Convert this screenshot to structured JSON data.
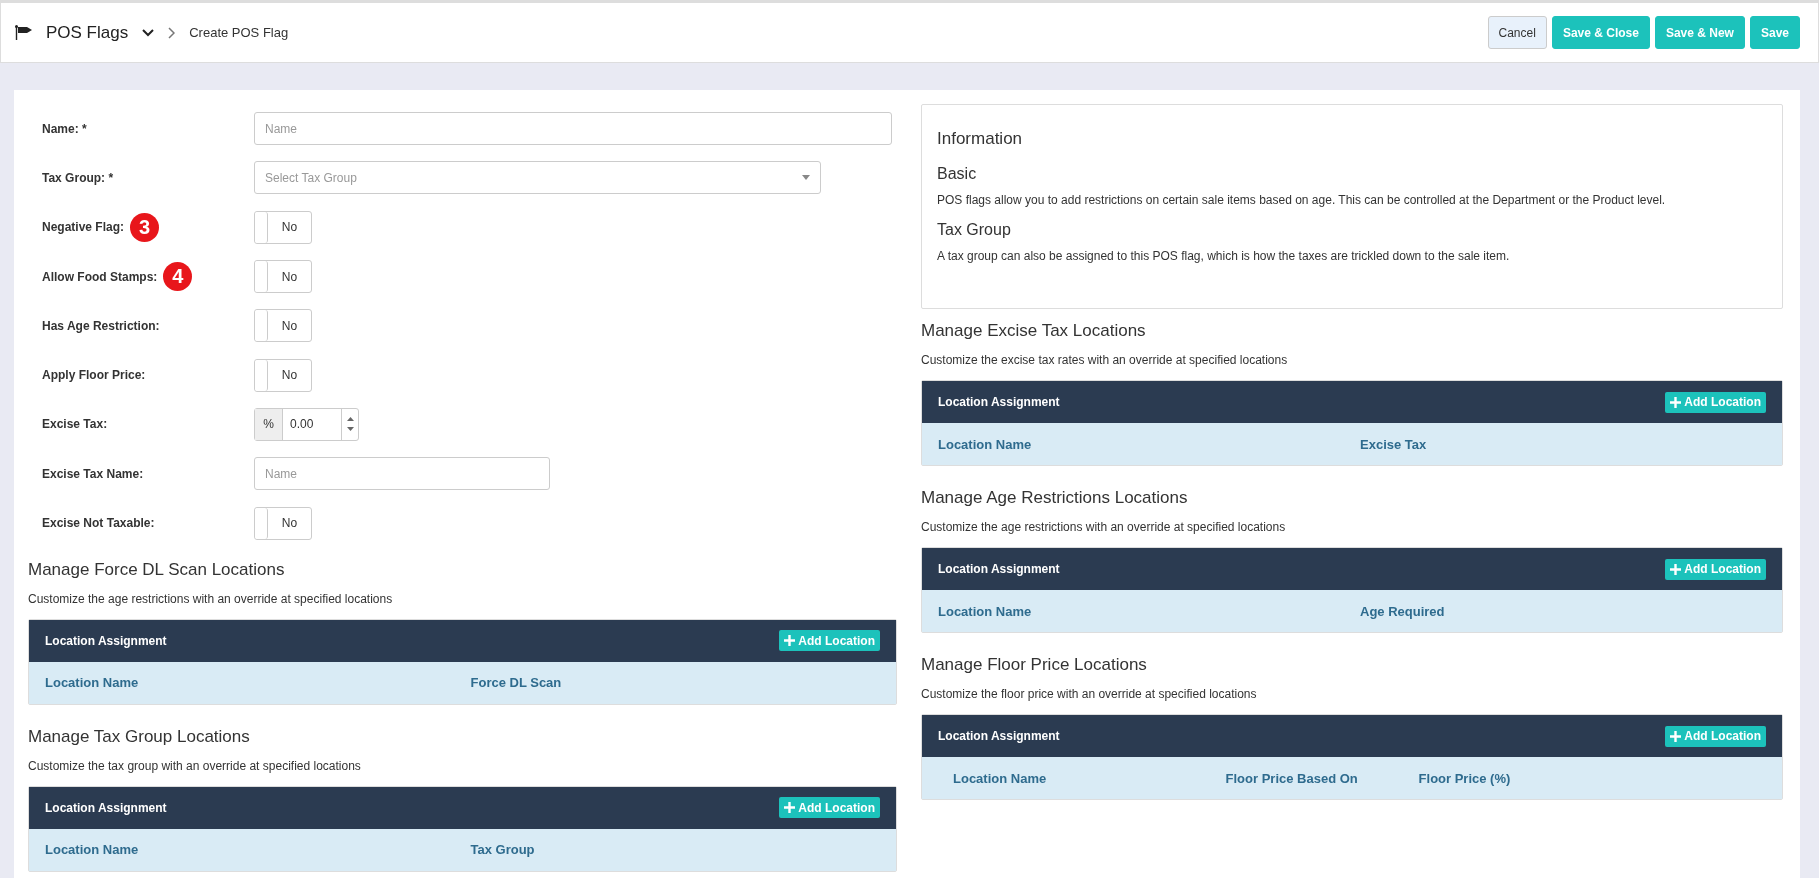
{
  "header": {
    "module": "POS Flags",
    "breadcrumb": "Create POS Flag",
    "buttons": [
      {
        "label": "Cancel",
        "kind": "secondary"
      },
      {
        "label": "Save & Close",
        "kind": "primary"
      },
      {
        "label": "Save & New",
        "kind": "primary"
      },
      {
        "label": "Save",
        "kind": "primary"
      }
    ]
  },
  "form": [
    {
      "kind": "wide_text",
      "label": "Name: *",
      "placeholder": "Name"
    },
    {
      "kind": "select",
      "label": "Tax Group: *",
      "placeholder": "Select Tax Group"
    },
    {
      "kind": "toggle",
      "label": "Negative Flag:",
      "value": "No",
      "on": false,
      "badge": "3"
    },
    {
      "kind": "toggle",
      "label": "Allow Food Stamps:",
      "value": "No",
      "on": false,
      "badge": "4"
    },
    {
      "kind": "toggle",
      "label": "Has Age Restriction:",
      "value": "No",
      "on": false
    },
    {
      "kind": "toggle",
      "label": "Apply Floor Price:",
      "value": "No",
      "on": false
    },
    {
      "kind": "number",
      "label": "Excise Tax:",
      "unit": "%",
      "value": "0.00"
    },
    {
      "kind": "text",
      "label": "Excise Tax Name:",
      "placeholder": "Name"
    },
    {
      "kind": "toggle",
      "label": "Excise Not Taxable:",
      "value": "No",
      "on": false
    }
  ],
  "left_sections": [
    {
      "title": "Manage Force DL Scan Locations",
      "subtitle": "Customize the age restrictions with an override at specified locations",
      "table_title": "Location Assignment",
      "add_button": "Add Location",
      "columns": [
        "Location Name",
        "Force DL Scan"
      ]
    },
    {
      "title": "Manage Tax Group Locations",
      "subtitle": "Customize the tax group with an override at specified locations",
      "table_title": "Location Assignment",
      "add_button": "Add Location",
      "columns": [
        "Location Name",
        "Tax Group"
      ]
    }
  ],
  "information": {
    "title": "Information",
    "blocks": [
      {
        "heading": "Basic",
        "text": "POS flags allow you to add restrictions on certain sale items based on age. This can be controlled at the Department or the Product level."
      },
      {
        "heading": "Tax Group",
        "text": "A tax group can also be assigned to this POS flag, which is how the taxes are trickled down to the sale item."
      }
    ]
  },
  "right_sections": [
    {
      "title": "Manage Excise Tax Locations",
      "subtitle": "Customize the excise tax rates with an override at specified locations",
      "table_title": "Location Assignment",
      "add_button": "Add Location",
      "columns": [
        "Location Name",
        "Excise Tax"
      ]
    },
    {
      "title": "Manage Age Restrictions Locations",
      "subtitle": "Customize the age restrictions with an override at specified locations",
      "table_title": "Location Assignment",
      "add_button": "Add Location",
      "columns": [
        "Location Name",
        "Age Required"
      ]
    },
    {
      "title": "Manage Floor Price Locations",
      "subtitle": "Customize the floor price with an override at specified locations",
      "table_title": "Location Assignment",
      "add_button": "Add Location",
      "columns": [
        "Location Name",
        "Floor Price Based On",
        "Floor Price (%)"
      ]
    }
  ]
}
